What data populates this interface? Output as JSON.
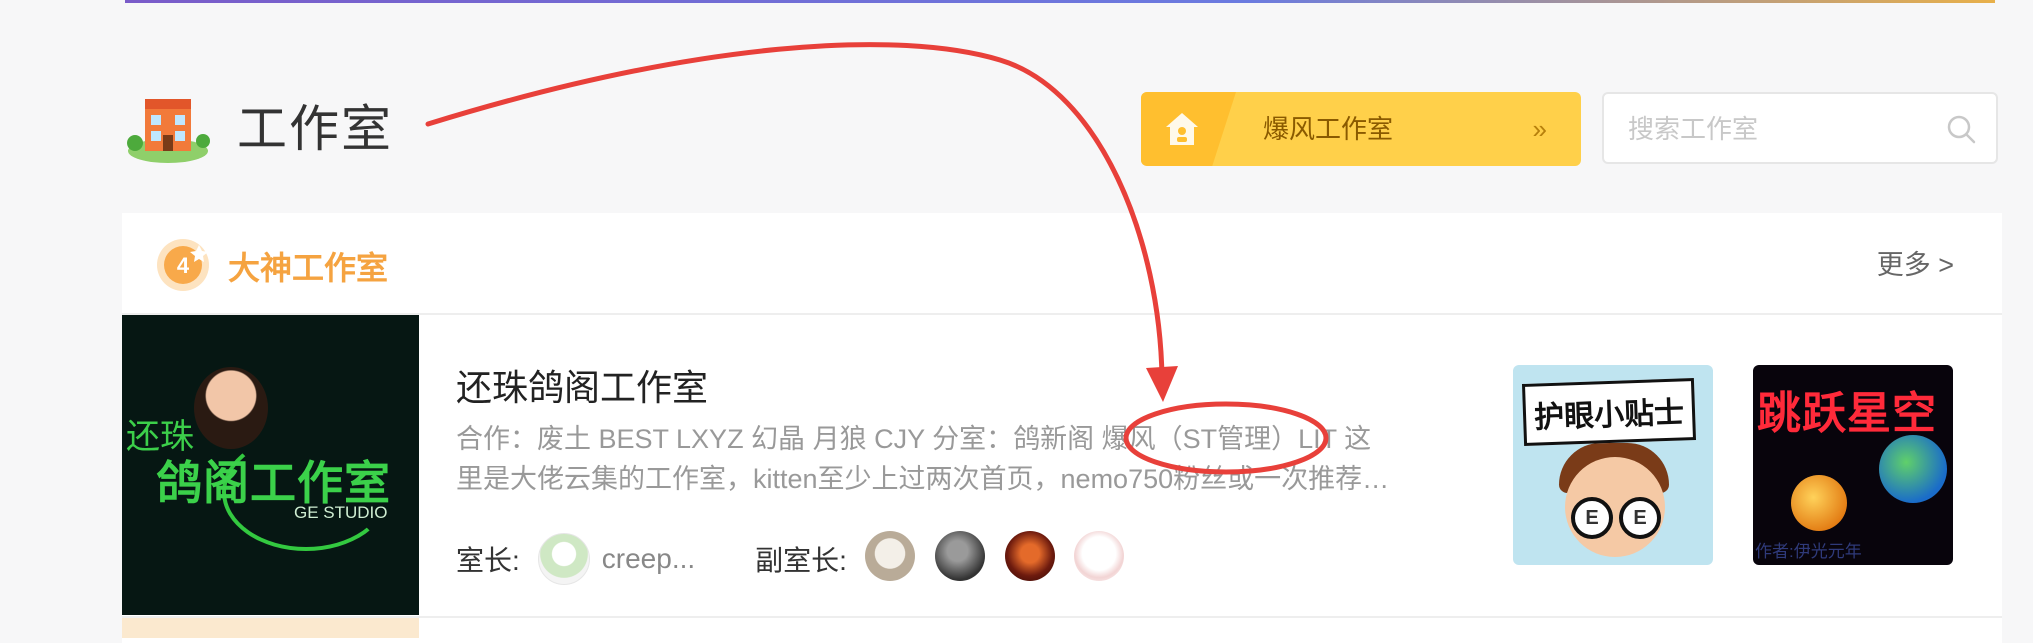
{
  "header": {
    "title": "工作室",
    "icon": "building-icon"
  },
  "studio_switch": {
    "name": "爆风工作室",
    "chevron": "»",
    "icon": "home-icon",
    "colors": {
      "bg": "#ffd04a",
      "accent": "#ffbf2f"
    }
  },
  "search": {
    "placeholder": "搜索工作室",
    "icon": "search-icon"
  },
  "section": {
    "title": "大神工作室",
    "badge_text": "4",
    "more": "更多 >",
    "accent": "#f5a340"
  },
  "studio": {
    "name": "还珠鸽阁工作室",
    "cover": {
      "line1": "还珠",
      "line2": "鸽阁工作室",
      "line3": "GE STUDIO"
    },
    "desc_line1": "合作：废土 BEST LXYZ 幻晶 月狼 CJY 分室：鸽新阁 爆风（ST管理）LIT 这",
    "desc_line2": "里是大佬云集的工作室，kitten至少上过两次首页，nemo750粉丝或一次推荐…",
    "owner_label": "室长:",
    "owner_name": "creep...",
    "vice_label": "副室长:",
    "thumbnails": [
      {
        "caption": "护眼小贴士"
      },
      {
        "caption": "跳跃星空",
        "author": "作者:伊光元年"
      }
    ]
  },
  "annotation": {
    "color": "#e8403a"
  }
}
